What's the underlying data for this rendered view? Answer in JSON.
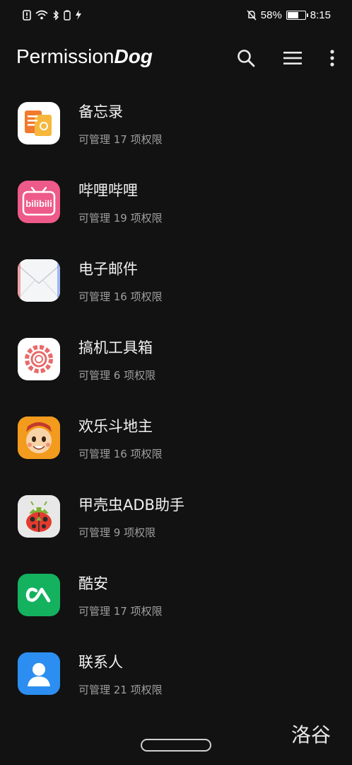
{
  "status_bar": {
    "battery": "58%",
    "time": "8:15",
    "icons": [
      "sim-alert-icon",
      "wifi-icon",
      "bluetooth-icon",
      "nfc-icon",
      "charging-icon",
      "bell-off-icon",
      "battery-icon"
    ]
  },
  "app_bar": {
    "title_plain": "Permission",
    "title_italic": "Dog",
    "actions": [
      "search-icon",
      "menu-icon",
      "more-vert-icon"
    ]
  },
  "apps": [
    {
      "name": "备忘录",
      "count": "可管理 17 项权限",
      "icon": "memo-icon"
    },
    {
      "name": "哔哩哔哩",
      "count": "可管理 19 项权限",
      "icon": "bilibili-icon"
    },
    {
      "name": "电子邮件",
      "count": "可管理 16 项权限",
      "icon": "email-icon"
    },
    {
      "name": "搞机工具箱",
      "count": "可管理 6 项权限",
      "icon": "gear-toolbox-icon"
    },
    {
      "name": "欢乐斗地主",
      "count": "可管理 16 项权限",
      "icon": "doudizhu-icon"
    },
    {
      "name": "甲壳虫ADB助手",
      "count": "可管理 9 项权限",
      "icon": "ladybug-android-icon"
    },
    {
      "name": "酷安",
      "count": "可管理 17 项权限",
      "icon": "coolapk-icon"
    },
    {
      "name": "联系人",
      "count": "可管理 21 项权限",
      "icon": "contacts-icon"
    }
  ],
  "watermark": "洛谷",
  "colors": {
    "background": "#121212",
    "secondary_text": "#9e9e9e"
  }
}
